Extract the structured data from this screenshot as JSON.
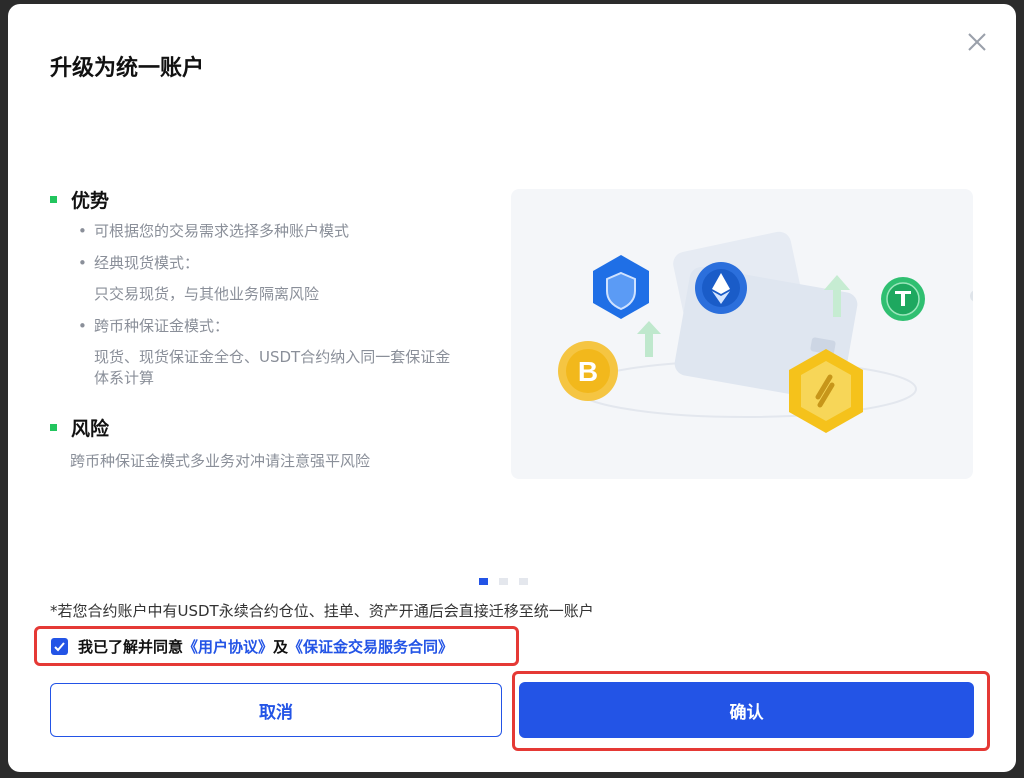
{
  "modal": {
    "title": "升级为统一账户"
  },
  "advantages": {
    "heading": "优势",
    "bullets": [
      {
        "lines": [
          "可根据您的交易需求选择多种账户模式"
        ]
      },
      {
        "lines": [
          "经典现货模式：",
          "只交易现货，与其他业务隔离风险"
        ]
      },
      {
        "lines": [
          "跨币种保证金模式：",
          "现货、现货保证金全仓、USDT合约纳入同一套保证金",
          "体系计算"
        ]
      }
    ]
  },
  "risk": {
    "heading": "风险",
    "text": "跨币种保证金模式多业务对冲请注意强平风险"
  },
  "carousel": {
    "current": 1,
    "total": 3
  },
  "note": "*若您合约账户中有USDT永续合约仓位、挂单、资产开通后会直接迁移至统一账户",
  "agreement": {
    "checked": true,
    "prefix": "我已了解并同意",
    "link1": "《用户协议》",
    "and": "及",
    "link2": "《保证金交易服务合同》"
  },
  "buttons": {
    "cancel": "取消",
    "confirm": "确认"
  },
  "colors": {
    "accent": "#2354e6",
    "bullet_dot": "#22c55e",
    "highlight": "#e53935"
  },
  "icons": [
    "close-icon",
    "check-icon",
    "shield-icon",
    "ethereum-icon",
    "tether-icon",
    "bitcoin-icon",
    "wallet-icon",
    "exchange-icon",
    "arrow-up-icon"
  ]
}
